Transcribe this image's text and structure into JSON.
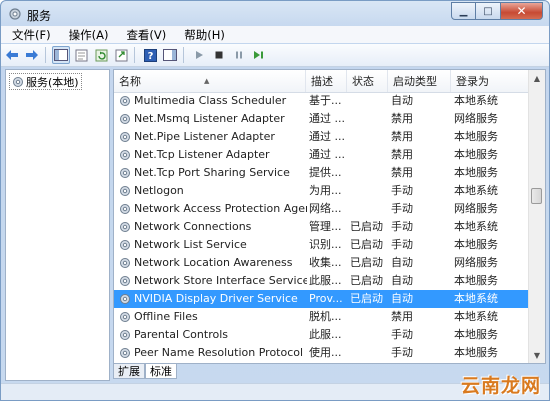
{
  "window": {
    "title": "服务"
  },
  "menu": [
    "文件(F)",
    "操作(A)",
    "查看(V)",
    "帮助(H)"
  ],
  "toolbar": {
    "icons": [
      "back-arrow-icon",
      "forward-arrow-icon",
      "console-tree-icon",
      "properties-icon",
      "refresh-icon",
      "export-icon",
      "help-icon",
      "show-hide-icon",
      "play-icon",
      "stop-icon",
      "pause-icon",
      "restart-icon"
    ]
  },
  "tree": {
    "item": "服务(本地)"
  },
  "table": {
    "columns": [
      "名称",
      "描述",
      "状态",
      "启动类型",
      "登录为"
    ],
    "rows": [
      {
        "name": "Multimedia Class Scheduler",
        "desc": "基于...",
        "status": "",
        "startup": "自动",
        "logon": "本地系统"
      },
      {
        "name": "Net.Msmq Listener Adapter",
        "desc": "通过 ...",
        "status": "",
        "startup": "禁用",
        "logon": "网络服务"
      },
      {
        "name": "Net.Pipe Listener Adapter",
        "desc": "通过 ...",
        "status": "",
        "startup": "禁用",
        "logon": "本地服务"
      },
      {
        "name": "Net.Tcp Listener Adapter",
        "desc": "通过 ...",
        "status": "",
        "startup": "禁用",
        "logon": "本地服务"
      },
      {
        "name": "Net.Tcp Port Sharing Service",
        "desc": "提供...",
        "status": "",
        "startup": "禁用",
        "logon": "本地服务"
      },
      {
        "name": "Netlogon",
        "desc": "为用...",
        "status": "",
        "startup": "手动",
        "logon": "本地系统"
      },
      {
        "name": "Network Access Protection Agent",
        "desc": "网络...",
        "status": "",
        "startup": "手动",
        "logon": "网络服务"
      },
      {
        "name": "Network Connections",
        "desc": "管理...",
        "status": "已启动",
        "startup": "手动",
        "logon": "本地系统"
      },
      {
        "name": "Network List Service",
        "desc": "识别...",
        "status": "已启动",
        "startup": "手动",
        "logon": "本地服务"
      },
      {
        "name": "Network Location Awareness",
        "desc": "收集...",
        "status": "已启动",
        "startup": "自动",
        "logon": "网络服务"
      },
      {
        "name": "Network Store Interface Service",
        "desc": "此服...",
        "status": "已启动",
        "startup": "自动",
        "logon": "本地服务"
      },
      {
        "name": "NVIDIA Display Driver Service",
        "desc": "Prov...",
        "status": "已启动",
        "startup": "自动",
        "logon": "本地系统",
        "selected": true
      },
      {
        "name": "Offline Files",
        "desc": "脱机...",
        "status": "",
        "startup": "禁用",
        "logon": "本地系统"
      },
      {
        "name": "Parental Controls",
        "desc": "此服...",
        "status": "",
        "startup": "手动",
        "logon": "本地服务"
      },
      {
        "name": "Peer Name Resolution Protocol",
        "desc": "使用...",
        "status": "",
        "startup": "手动",
        "logon": "本地服务"
      }
    ]
  },
  "tabs": [
    "扩展",
    "标准"
  ],
  "watermark": "云南龙网",
  "colors": {
    "selection": "#3399ff",
    "watermark": "#d97a1f"
  }
}
